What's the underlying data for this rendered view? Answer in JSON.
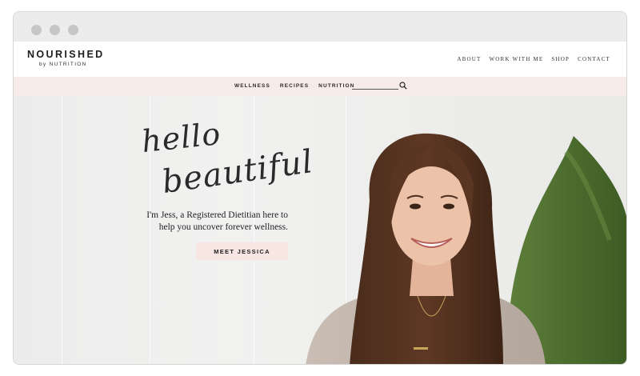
{
  "brand": {
    "name": "NOURISHED",
    "tagline": "by NUTRITION"
  },
  "main_nav": [
    "ABOUT",
    "WORK WITH ME",
    "SHOP",
    "CONTACT"
  ],
  "sub_nav": [
    "WELLNESS",
    "RECIPES",
    "NUTRITION"
  ],
  "search": {
    "placeholder": ""
  },
  "hero": {
    "script_line1": "hello",
    "script_line2": "beautiful",
    "intro": "I'm Jess, a Registered Dietitian here to help you uncover forever wellness.",
    "cta": "MEET JESSICA"
  },
  "colors": {
    "chrome": "#ececec",
    "subnav_bg": "#f7ebe8",
    "cta_bg": "#f7e6e1",
    "text": "#222222"
  }
}
